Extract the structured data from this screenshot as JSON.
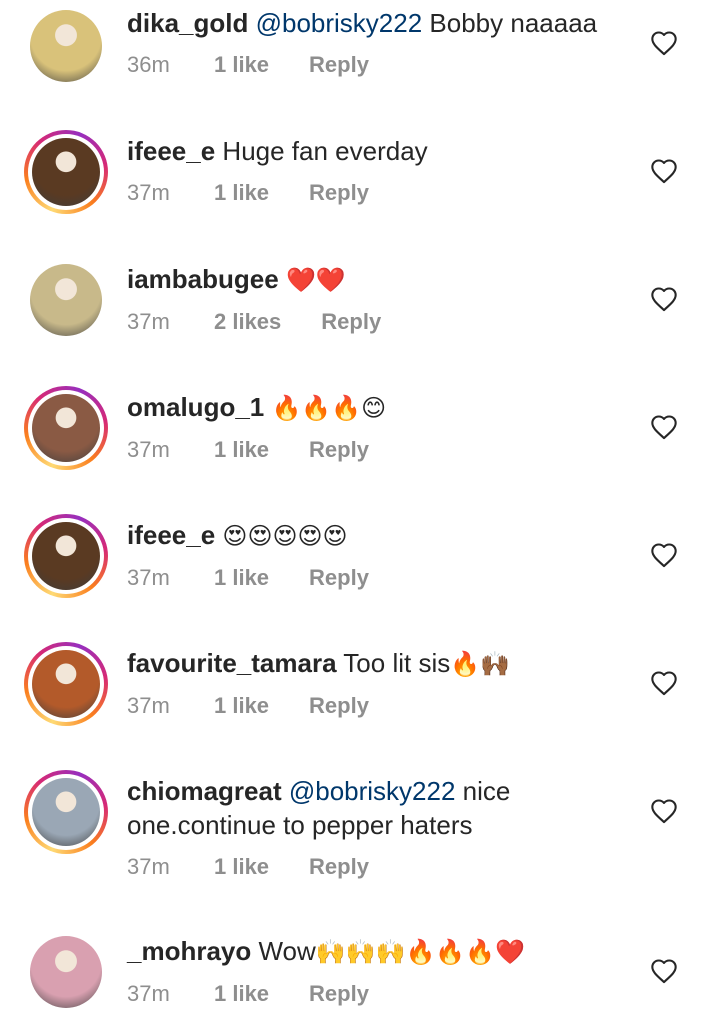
{
  "comments": [
    {
      "username": "dika_gold",
      "mention": "@bobrisky222",
      "text": " Bobby naaaaa",
      "emoji": "",
      "time": "36m",
      "likes": "1 like",
      "reply": "Reply",
      "story_ring": false,
      "avatar_color": "#d9c27a"
    },
    {
      "username": "ifeee_e",
      "mention": "",
      "text": " Huge fan everday",
      "emoji": "",
      "time": "37m",
      "likes": "1 like",
      "reply": "Reply",
      "story_ring": true,
      "avatar_color": "#5a3a22"
    },
    {
      "username": "iambabugee",
      "mention": "",
      "text": " ",
      "emoji": "❤️❤️",
      "time": "37m",
      "likes": "2 likes",
      "reply": "Reply",
      "story_ring": false,
      "avatar_color": "#c8b98a"
    },
    {
      "username": "omalugo_1",
      "mention": "",
      "text": " ",
      "emoji": "🔥🔥🔥😊",
      "time": "37m",
      "likes": "1 like",
      "reply": "Reply",
      "story_ring": true,
      "avatar_color": "#8a5a44"
    },
    {
      "username": "ifeee_e",
      "mention": "",
      "text": " ",
      "emoji": "😍😍😍😍😍",
      "time": "37m",
      "likes": "1 like",
      "reply": "Reply",
      "story_ring": true,
      "avatar_color": "#5a3a22"
    },
    {
      "username": "favourite_tamara",
      "mention": "",
      "text": " Too lit sis",
      "emoji": "🔥🙌🏾",
      "time": "37m",
      "likes": "1 like",
      "reply": "Reply",
      "story_ring": true,
      "avatar_color": "#b35a2a"
    },
    {
      "username": "chiomagreat",
      "mention": "@bobrisky222",
      "text": " nice one.continue to pepper haters",
      "emoji": "",
      "time": "37m",
      "likes": "1 like",
      "reply": "Reply",
      "story_ring": true,
      "avatar_color": "#9aa7b5"
    },
    {
      "username": "_mohrayo",
      "mention": "",
      "text": " Wow",
      "emoji": "🙌🙌🙌🔥🔥🔥❤️",
      "time": "37m",
      "likes": "1 like",
      "reply": "Reply",
      "story_ring": false,
      "avatar_color": "#d9a0b0"
    }
  ],
  "icons": {
    "heart": "heart-outline-icon"
  },
  "colors": {
    "text": "#262626",
    "mention": "#00376b",
    "meta": "#8e8e8e"
  }
}
